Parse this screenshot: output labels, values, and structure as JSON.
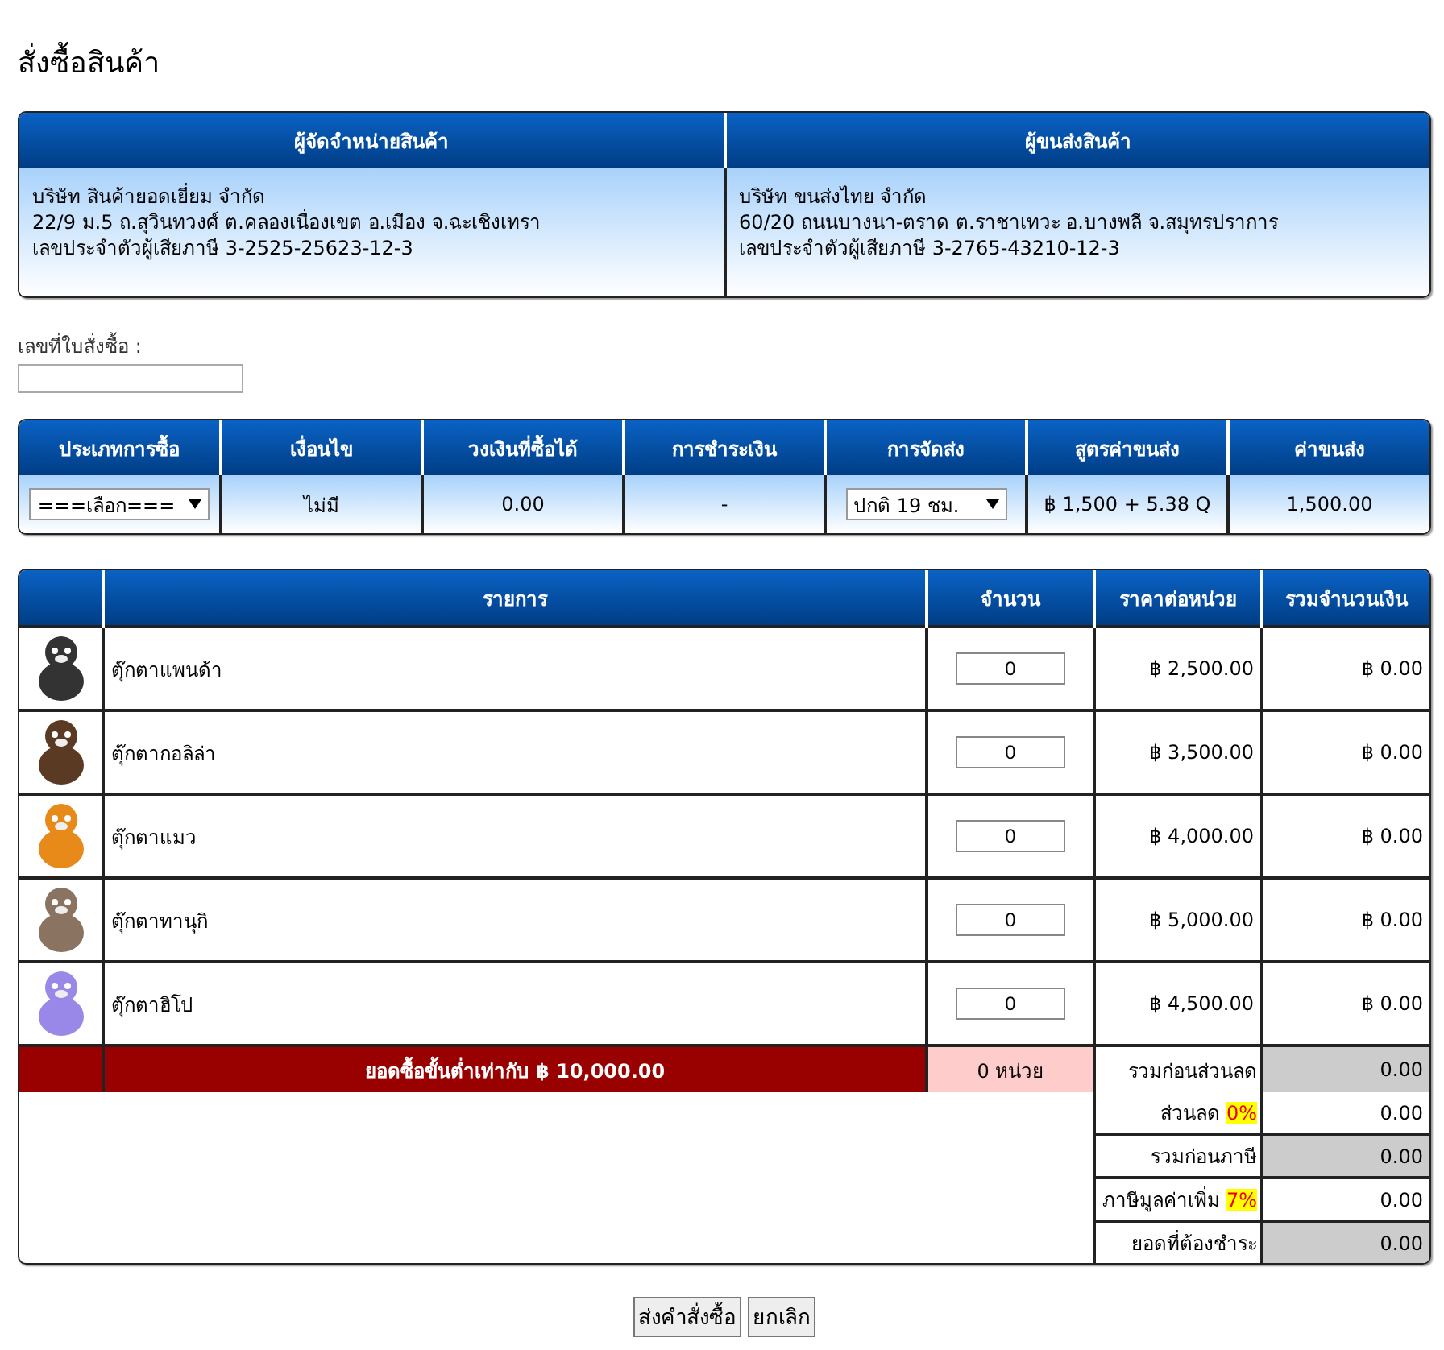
{
  "title": "สั่งซื้อสินค้า",
  "parties": [
    {
      "heading": "ผู้จัดจำหน่ายสินค้า",
      "lines": [
        "บริษัท สินค้ายอดเยี่ยม จำกัด",
        "22/9 ม.5 ถ.สุวินทวงศ์ ต.คลองเนื่องเขต อ.เมือง จ.ฉะเชิงเทรา",
        "เลขประจำตัวผู้เสียภาษี 3-2525-25623-12-3"
      ]
    },
    {
      "heading": "ผู้ขนส่งสินค้า",
      "lines": [
        "บริษัท ขนส่งไทย จำกัด",
        "60/20 ถนนบางนา-ตราด ต.ราชาเทวะ อ.บางพลี จ.สมุทรปราการ",
        "เลขประจำตัวผู้เสียภาษี 3-2765-43210-12-3"
      ]
    }
  ],
  "order_number": {
    "label": "เลขที่ใบสั่งซื้อ :"
  },
  "terms": {
    "columns": [
      "ประเภทการซื้อ",
      "เงื่อนไข",
      "วงเงินที่ซื้อได้",
      "การชำระเงิน",
      "การจัดส่ง",
      "สูตรค่าขนส่ง",
      "ค่าขนส่ง"
    ],
    "cells": [
      {
        "kind": "select",
        "text": "===เลือก==="
      },
      {
        "kind": "text",
        "text": "ไม่มี"
      },
      {
        "kind": "text",
        "text": "0.00"
      },
      {
        "kind": "text",
        "text": "-"
      },
      {
        "kind": "select",
        "text": "ปกติ 19 ชม."
      },
      {
        "kind": "text",
        "text": "฿ 1,500 + 5.38 Q"
      },
      {
        "kind": "text",
        "text": "1,500.00"
      }
    ]
  },
  "items": {
    "columns": [
      "รายการ",
      "จำนวน",
      "ราคาต่อหน่วย",
      "รวมจำนวนเงิน"
    ],
    "rows": [
      {
        "name": "ตุ๊กตาแพนด้า",
        "color": "#333333",
        "quantity": "0",
        "price": "฿ 2,500.00",
        "total": "฿ 0.00"
      },
      {
        "name": "ตุ๊กตากอลิล่า",
        "color": "#5a3a22",
        "quantity": "0",
        "price": "฿ 3,500.00",
        "total": "฿ 0.00"
      },
      {
        "name": "ตุ๊กตาแมว",
        "color": "#e88a1a",
        "quantity": "0",
        "price": "฿ 4,000.00",
        "total": "฿ 0.00"
      },
      {
        "name": "ตุ๊กตาทานุกิ",
        "color": "#8a7360",
        "quantity": "0",
        "price": "฿ 5,000.00",
        "total": "฿ 0.00"
      },
      {
        "name": "ตุ๊กตาฮิโป",
        "color": "#9a88e8",
        "quantity": "0",
        "price": "฿ 4,500.00",
        "total": "฿ 0.00"
      }
    ],
    "minimum": "ยอดซื้อขั้นต่ำเท่ากับ ฿ 10,000.00",
    "units": "0  หน่วย",
    "summary": [
      {
        "label": "รวมก่อนส่วนลด",
        "value": "0.00",
        "shaded": true
      },
      {
        "label": "ส่วนลด",
        "rate": "0%",
        "value": "0.00",
        "shaded": false
      },
      {
        "label": "รวมก่อนภาษี",
        "value": "0.00",
        "shaded": true
      },
      {
        "label": "ภาษีมูลค่าเพิ่ม",
        "rate": "7%",
        "value": "0.00",
        "shaded": false
      },
      {
        "label": "ยอดที่ต้องชำระ",
        "value": "0.00",
        "shaded": true
      }
    ]
  },
  "buttons": [
    "ส่งคำสั่งซื้อ",
    "ยกเลิก"
  ]
}
